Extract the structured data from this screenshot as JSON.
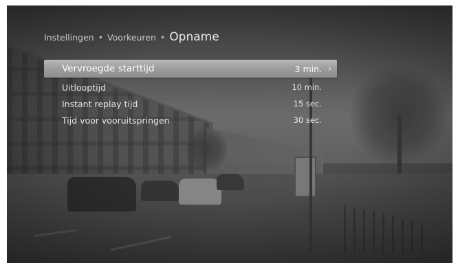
{
  "breadcrumb": {
    "items": [
      "Instellingen",
      "Voorkeuren"
    ],
    "separator": "•",
    "current": "Opname"
  },
  "menu": {
    "items": [
      {
        "label": "Vervroegde starttijd",
        "value": "3 min.",
        "selected": true
      },
      {
        "label": "Uitlooptijd",
        "value": "10 min.",
        "selected": false
      },
      {
        "label": "Instant replay tijd",
        "value": "15 sec.",
        "selected": false
      },
      {
        "label": "Tijd voor vooruitspringen",
        "value": "30 sec.",
        "selected": false
      }
    ],
    "selected_indicator_icon": "chevron-right-icon"
  },
  "colors": {
    "highlight": "#a4a4a4",
    "text": "#e6e6e6",
    "breadcrumb_text": "#c6c6c6"
  }
}
